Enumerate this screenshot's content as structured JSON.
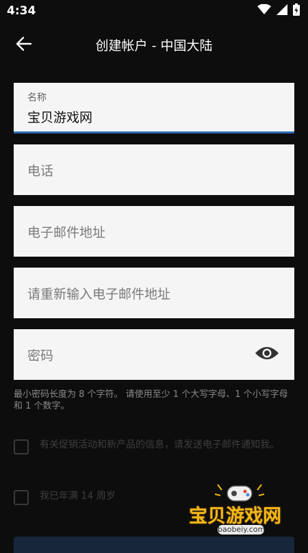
{
  "status_bar": {
    "time": "4:34",
    "icons": [
      "wifi-icon",
      "signal-icon",
      "battery-icon"
    ]
  },
  "app_bar": {
    "back_icon": "arrow-left-icon",
    "title": "创建帐户 - 中国大陆"
  },
  "form": {
    "name": {
      "label": "名称",
      "value": "宝贝游戏网"
    },
    "phone": {
      "placeholder": "电话"
    },
    "email": {
      "placeholder": "电子邮件地址"
    },
    "email_confirm": {
      "placeholder": "请重新输入电子邮件地址"
    },
    "password": {
      "placeholder": "密码",
      "toggle_icon": "eye-icon"
    }
  },
  "password_hint": "最小密码长度为 8 个字符。 请使用至少 1 个大写字母、1 个小写字母和 1 个数字。",
  "checkboxes": {
    "promo": {
      "label": "有关促销活动和新产品的信息，请发送电子邮件通知我。",
      "checked": false
    },
    "age": {
      "label": "我已年满 14 周岁",
      "checked": false
    }
  },
  "watermark": {
    "text": "宝贝游戏网",
    "url": "baobeiy.com"
  },
  "colors": {
    "background": "#0d0d0d",
    "field_background": "#f5f5f5",
    "focus_underline": "#2f6db5",
    "hint_text": "#8a8a8a",
    "watermark_gold": "#f2b818"
  }
}
